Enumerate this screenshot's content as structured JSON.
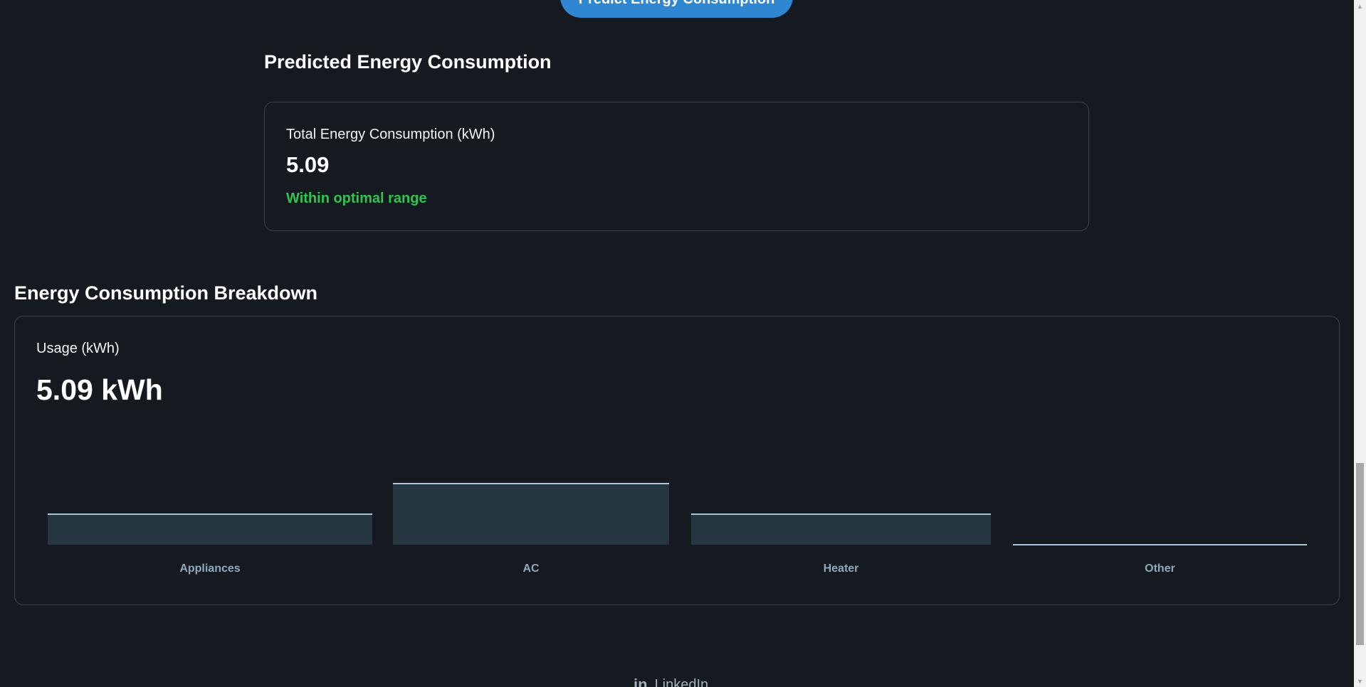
{
  "header": {
    "predict_button_label": "Predict Energy Consumption"
  },
  "prediction": {
    "heading": "Predicted Energy Consumption",
    "card_label": "Total Energy Consumption (kWh)",
    "value": "5.09",
    "status": "Within optimal range",
    "status_color": "#2fc452"
  },
  "breakdown": {
    "heading": "Energy Consumption Breakdown",
    "usage_label": "Usage (kWh)",
    "usage_total": "5.09 kWh"
  },
  "chart_data": {
    "type": "bar",
    "categories": [
      "Appliances",
      "AC",
      "Heater",
      "Other"
    ],
    "values": [
      0.5,
      1.0,
      0.5,
      0.0
    ],
    "ylim": [
      0,
      1.0
    ],
    "title": "",
    "xlabel": "",
    "ylabel": "",
    "grid": false,
    "bar_color": "#263641",
    "bar_top_color": "#a9c6da"
  },
  "footer": {
    "linkedin_icon": "in",
    "linkedin_label": "LinkedIn"
  },
  "theme": {
    "background": "#141a20",
    "accent": "#2f86d1",
    "border": "#39434d"
  }
}
